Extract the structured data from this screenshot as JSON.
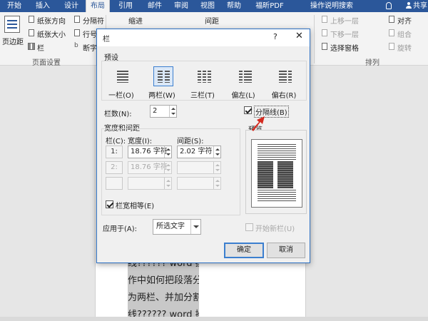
{
  "ribbon_tabs": [
    "开始",
    "插入",
    "设计",
    "布局",
    "引用",
    "邮件",
    "审阅",
    "视图",
    "帮助",
    "福昕PDF",
    "操作说明搜索"
  ],
  "share_label": "共享",
  "ribbon": {
    "page_setup": {
      "margins_label": "页边距",
      "orientation_label": "纸张方向",
      "size_label": "纸张大小",
      "columns_label": "栏",
      "breaks_label": "分隔符",
      "line_numbers_label": "行号",
      "hyphenation_label": "断字",
      "group_label": "页面设置"
    },
    "paragraph": {
      "indent_label": "缩进",
      "spacing_label": "间距"
    },
    "arrange": {
      "bring_forward_label": "上移一层",
      "send_backward_label": "下移一层",
      "selection_pane_label": "选择窗格",
      "align_label": "对齐",
      "group_obj_label": "组合",
      "rotate_label": "旋转",
      "group_label": "排列"
    }
  },
  "document_lines": [
    "线?????? word 操",
    "作中如何把段落分",
    "为两栏、并加分割",
    "线?????? word 操"
  ],
  "dialog": {
    "title": "栏",
    "help": "?",
    "close": "✕",
    "presets_label": "预设",
    "presets": [
      {
        "label": "一栏(O)",
        "icon": "one-column-icon",
        "selected": false
      },
      {
        "label": "两栏(W)",
        "icon": "two-columns-icon",
        "selected": true
      },
      {
        "label": "三栏(T)",
        "icon": "three-columns-icon",
        "selected": false
      },
      {
        "label": "偏左(L)",
        "icon": "left-column-icon",
        "selected": false
      },
      {
        "label": "偏右(R)",
        "icon": "right-column-icon",
        "selected": false
      }
    ],
    "num_columns_label": "栏数(N):",
    "num_columns_value": "2",
    "line_between_label": "分隔线(B)",
    "line_between_checked": true,
    "width_spacing_label": "宽度和间距",
    "col_header": "栏(C):",
    "width_header": "宽度(I):",
    "spacing_header": "间距(S):",
    "rows": [
      {
        "num": "1:",
        "width": "18.76 字符",
        "spacing": "2.02 字符",
        "disabled": false
      },
      {
        "num": "2:",
        "width": "18.76 字符",
        "spacing": "",
        "disabled": true
      },
      {
        "num": "",
        "width": "",
        "spacing": "",
        "disabled": true
      }
    ],
    "equal_width_label": "栏宽相等(E)",
    "equal_width_checked": true,
    "preview_label": "预览",
    "apply_to_label": "应用于(A):",
    "apply_to_value": "所选文字",
    "new_column_label": "开始新栏(U)",
    "new_column_checked": false,
    "ok_label": "确定",
    "cancel_label": "取消"
  },
  "colors": {
    "ribbon_blue": "#2b579a",
    "selection_blue": "#3c7fcf",
    "annotation_red": "#d42a1f"
  }
}
